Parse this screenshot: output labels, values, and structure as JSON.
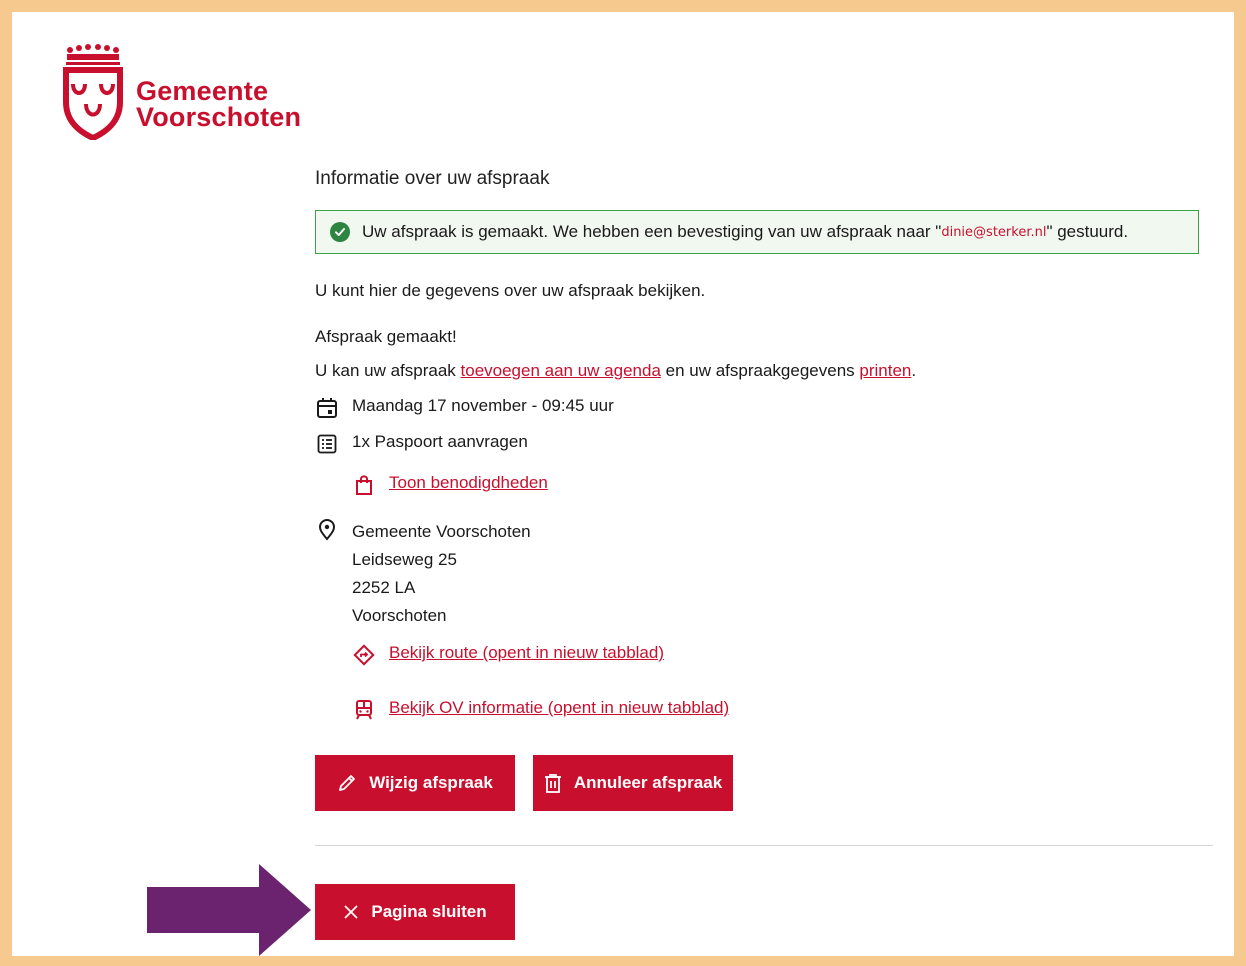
{
  "brand": {
    "line1": "Gemeente",
    "line2": "Voorschoten",
    "color": "#c8102e"
  },
  "page": {
    "title": "Informatie over uw afspraak",
    "alert": {
      "prefix": "Uw afspraak is gemaakt. We hebben een bevestiging van uw afspraak naar \"",
      "email": "dinie@sterker.nl",
      "suffix": "\" gestuurd."
    },
    "intro": "U kunt hier de gegevens over uw afspraak bekijken.",
    "made": "Afspraak gemaakt!",
    "line": {
      "part1": "U kan uw afspraak ",
      "link1": "toevoegen aan uw agenda",
      "part2": " en uw afspraakgegevens ",
      "link2": "printen",
      "part3": "."
    },
    "date": "Maandag 17 november - 09:45 uur",
    "product": "1x Paspoort aanvragen",
    "requirements_link": "Toon benodigdheden",
    "address": {
      "name": "Gemeente Voorschoten",
      "street": "Leidseweg 25",
      "postcode": "2252 LA",
      "city": "Voorschoten"
    },
    "route_link": "Bekijk route (opent in nieuw tabblad)",
    "ov_link": "Bekijk OV informatie (opent in nieuw tabblad)"
  },
  "buttons": {
    "edit": "Wijzig afspraak",
    "cancel": "Annuleer afspraak",
    "close": "Pagina sluiten"
  },
  "icons": {
    "alert": "check-circle-icon",
    "date": "calendar-icon",
    "product": "list-icon",
    "requirements": "shopping-bag-icon",
    "location": "location-pin-icon",
    "route": "directions-icon",
    "ov": "train-icon",
    "edit": "pencil-icon",
    "cancel": "trash-icon",
    "close": "close-icon",
    "annotation": "arrow-right-icon"
  },
  "colors": {
    "accent": "#c8102e",
    "success": "#2e8540",
    "frame": "#f6c98e",
    "arrow": "#6b2370"
  }
}
